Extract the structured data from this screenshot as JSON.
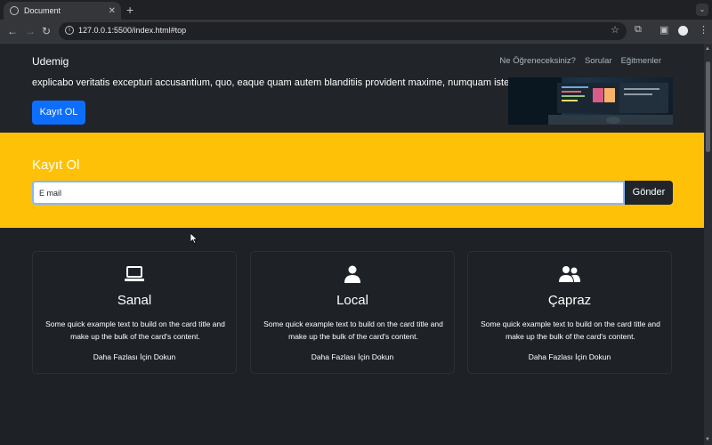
{
  "browser": {
    "tab_title": "Document",
    "url": "127.0.0.1:5500/index.html#top"
  },
  "page": {
    "brand": "Udemig",
    "nav": [
      {
        "label": "Ne Öğreneceksiniz?"
      },
      {
        "label": "Sorular"
      },
      {
        "label": "Eğitmenler"
      }
    ],
    "hero_text": "explicabo veritatis excepturi accusantium, quo, eaque quam autem blanditiis provident maxime, numquam iste.",
    "hero_button": "Kayıt OL",
    "signup": {
      "title": "Kayıt Ol",
      "email_placeholder": "E mail",
      "button": "Gönder"
    },
    "cards": [
      {
        "icon": "laptop-icon",
        "title": "Sanal",
        "text": "Some quick example text to build on the card title and make up the bulk of the card's content.",
        "link": "Daha Fazlası İçin Dokun"
      },
      {
        "icon": "person-icon",
        "title": "Local",
        "text": "Some quick example text to build on the card title and make up the bulk of the card's content.",
        "link": "Daha Fazlası İçin Dokun"
      },
      {
        "icon": "people-icon",
        "title": "Çapraz",
        "text": "Some quick example text to build on the card title and make up the bulk of the card's content.",
        "link": "Daha Fazlası İçin Dokun"
      }
    ]
  },
  "colors": {
    "primary": "#0d6efd",
    "warning": "#ffc107",
    "dark": "#212529"
  }
}
